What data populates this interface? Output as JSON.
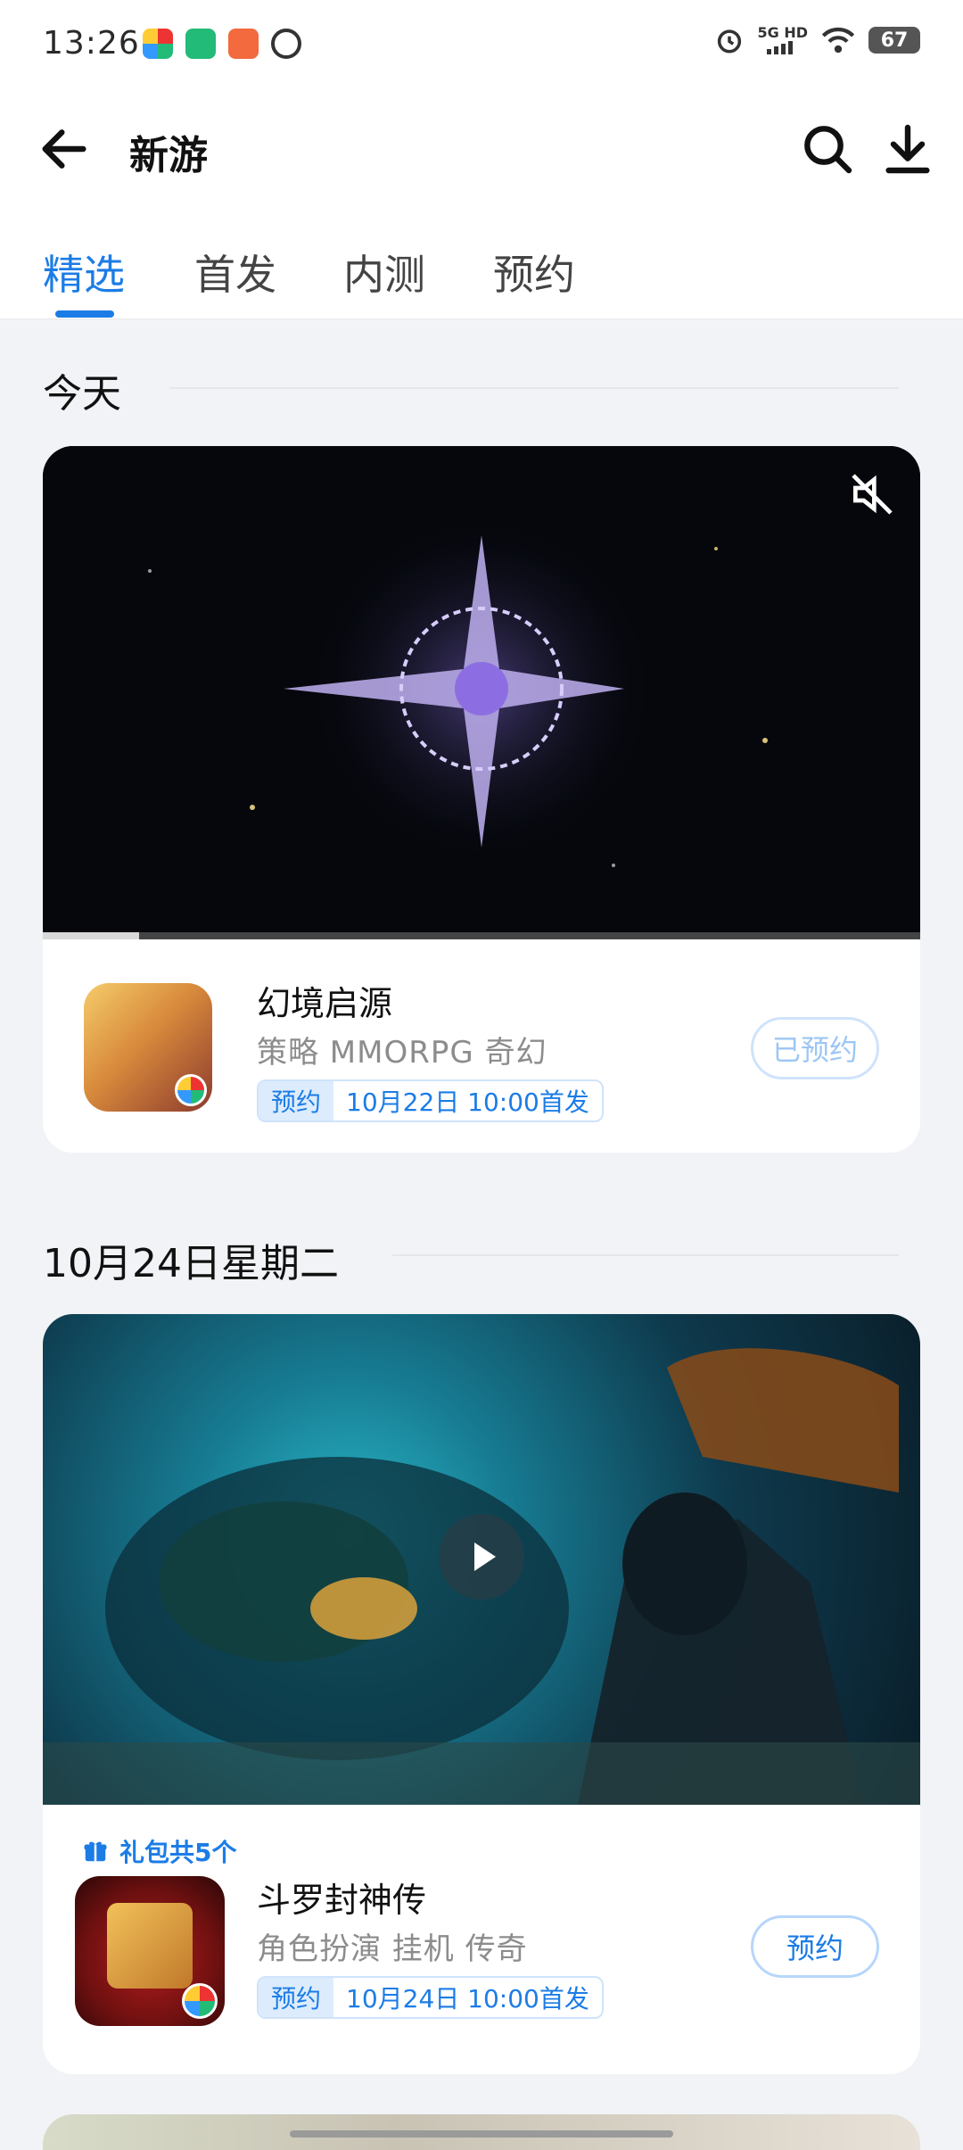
{
  "status_bar": {
    "time": "13:26",
    "signal_text": "5G HD",
    "battery": "67"
  },
  "header": {
    "title": "新游"
  },
  "tabs": [
    {
      "label": "精选",
      "active": true
    },
    {
      "label": "首发",
      "active": false
    },
    {
      "label": "内测",
      "active": false
    },
    {
      "label": "预约",
      "active": false
    }
  ],
  "sections": [
    {
      "heading": "今天",
      "card": {
        "video": {
          "muted": true,
          "progress": 0.11
        },
        "game": {
          "name": "幻境启源",
          "tags": "策略  MMORPG  奇幻",
          "release_badge": "预约",
          "release_text": "10月22日 10:00首发",
          "button_label": "已预约"
        }
      }
    },
    {
      "heading": "10月24日星期二",
      "card": {
        "video": {
          "playable": true
        },
        "gift_text": "礼包共5个",
        "game": {
          "name": "斗罗封神传",
          "tags": "角色扮演  挂机  传奇",
          "release_badge": "预约",
          "release_text": "10月24日 10:00首发",
          "button_label": "预约"
        }
      }
    }
  ],
  "colors": {
    "accent": "#1c7ce6",
    "background": "#f1f3f6",
    "card": "#ffffff"
  }
}
